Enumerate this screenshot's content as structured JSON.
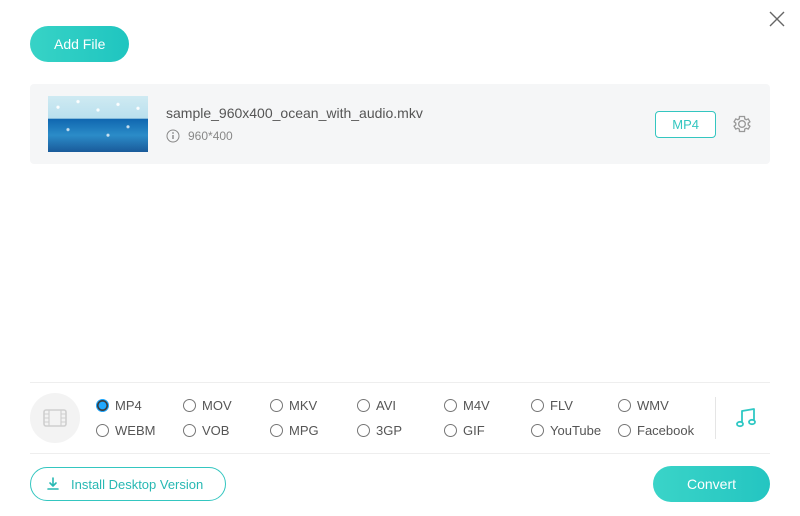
{
  "colors": {
    "accent": "#2fc8c4",
    "accent_gradient_start": "#37d3c6",
    "accent_gradient_end": "#1fc5c0"
  },
  "buttons": {
    "add_file": "Add File",
    "install": "Install Desktop Version",
    "convert": "Convert"
  },
  "file": {
    "name": "sample_960x400_ocean_with_audio.mkv",
    "resolution": "960*400",
    "output_format": "MP4"
  },
  "formats": {
    "selected": "MP4",
    "row1": [
      "MP4",
      "MOV",
      "MKV",
      "AVI",
      "M4V",
      "FLV",
      "WMV"
    ],
    "row2": [
      "WEBM",
      "VOB",
      "MPG",
      "3GP",
      "GIF",
      "YouTube",
      "Facebook"
    ]
  }
}
